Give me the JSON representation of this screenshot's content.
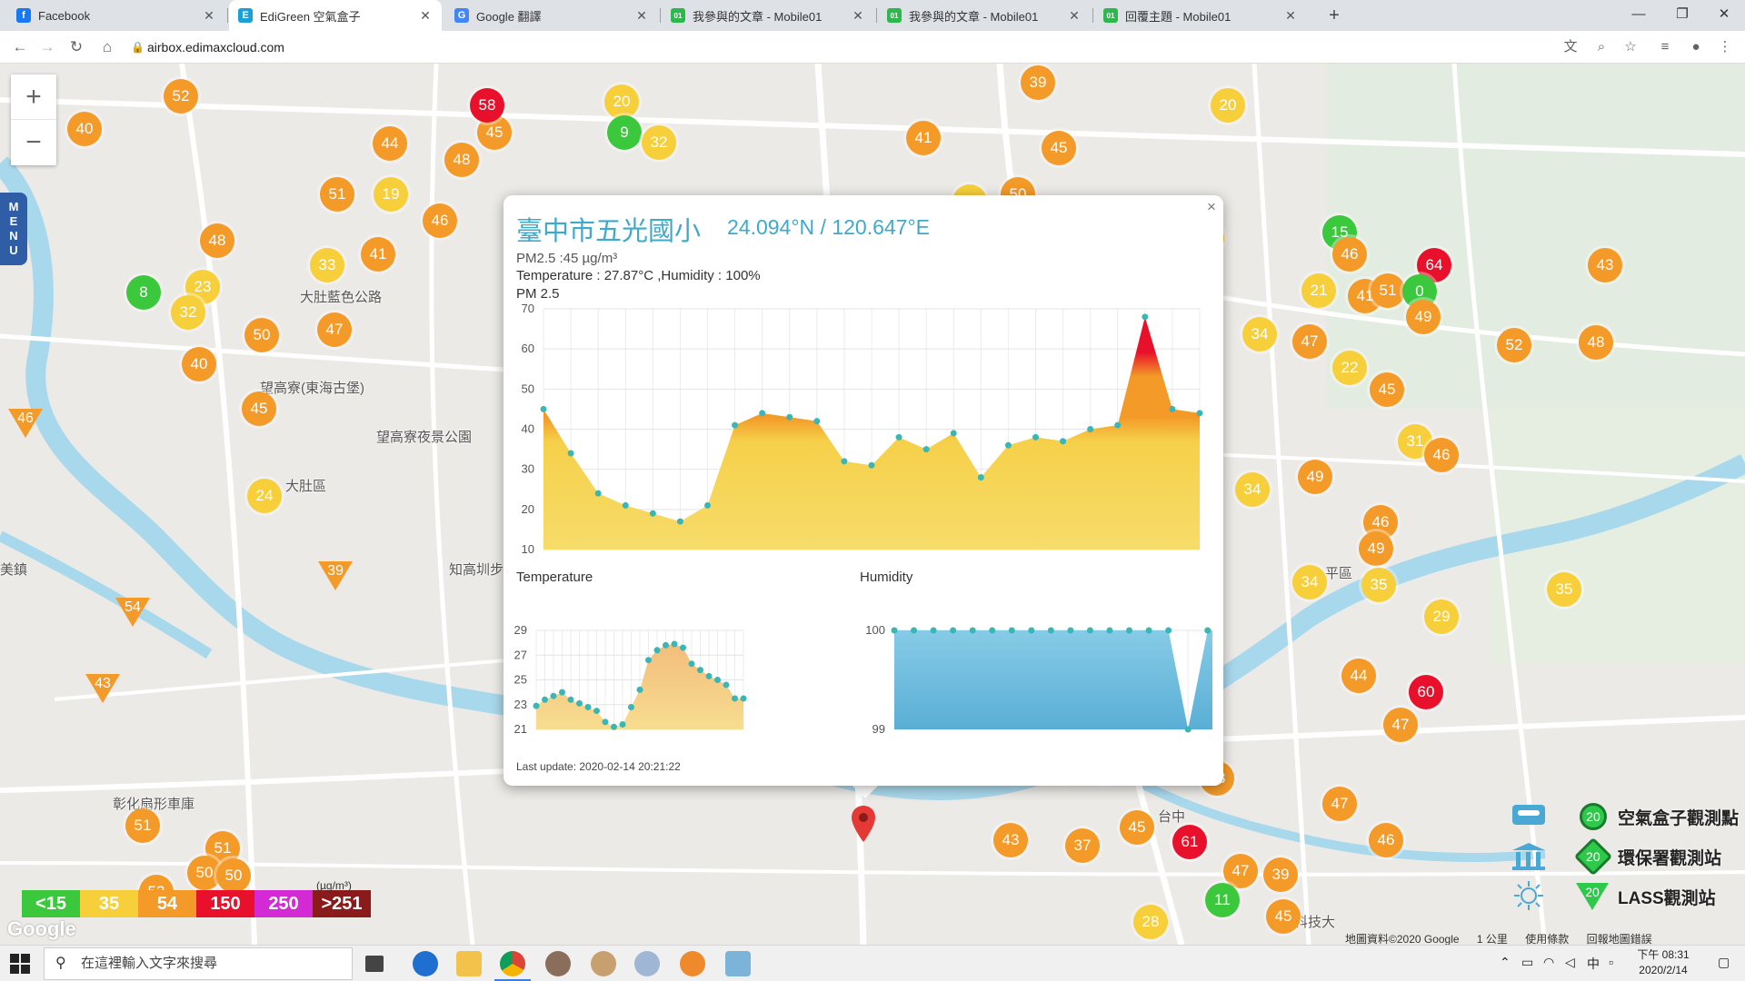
{
  "browser": {
    "tabs": [
      {
        "title": "Facebook",
        "favicon": "facebook-icon",
        "color": "#1877f2",
        "glyph": "f"
      },
      {
        "title": "EdiGreen 空氣盒子",
        "favicon": "edigreen-icon",
        "color": "#1a9fd6",
        "glyph": "E",
        "active": true
      },
      {
        "title": "Google 翻譯",
        "favicon": "google-translate-icon",
        "color": "#4285f4",
        "glyph": "G"
      },
      {
        "title": "我參與的文章 - Mobile01",
        "favicon": "mobile01-icon",
        "color": "#2db84c",
        "glyph": "01"
      },
      {
        "title": "我參與的文章 - Mobile01",
        "favicon": "mobile01-icon",
        "color": "#2db84c",
        "glyph": "01"
      },
      {
        "title": "回覆主題 - Mobile01",
        "favicon": "mobile01-icon",
        "color": "#2db84c",
        "glyph": "01"
      }
    ],
    "url": "airbox.edimaxcloud.com"
  },
  "map": {
    "labels": [
      {
        "text": "大肚藍色公路"
      },
      {
        "text": "望高寮(東海古堡)"
      },
      {
        "text": "望高寮夜景公園"
      },
      {
        "text": "大肚區"
      },
      {
        "text": "知高圳步"
      },
      {
        "text": "美鎮"
      },
      {
        "text": "彰化扇形車庫"
      },
      {
        "text": "平區"
      },
      {
        "text": "台中"
      },
      {
        "text": "科技大"
      }
    ],
    "zoom_in": "+",
    "zoom_out": "−",
    "menu_letters": [
      "M",
      "E",
      "N",
      "U"
    ],
    "markers": [
      {
        "v": "52",
        "c": "#f39a28"
      },
      {
        "v": "40",
        "c": "#f39a28"
      },
      {
        "v": "44",
        "c": "#f39a28"
      },
      {
        "v": "45",
        "c": "#f39a28"
      },
      {
        "v": "19",
        "c": "#f6cf3a"
      },
      {
        "v": "46",
        "c": "#f39a28"
      },
      {
        "v": "47",
        "c": "#f39a28"
      },
      {
        "v": "41",
        "c": "#f39a28"
      },
      {
        "v": "50",
        "c": "#f39a28"
      },
      {
        "v": "45",
        "c": "#f39a28"
      },
      {
        "v": "51",
        "c": "#f39a28"
      },
      {
        "v": "48",
        "c": "#f39a28"
      },
      {
        "v": "8",
        "c": "#3cc83c"
      },
      {
        "v": "23",
        "c": "#f6cf3a"
      },
      {
        "v": "33",
        "c": "#f6cf3a"
      },
      {
        "v": "32",
        "c": "#f6cf3a"
      },
      {
        "v": "50",
        "c": "#f39a28"
      },
      {
        "v": "40",
        "c": "#f39a28"
      },
      {
        "v": "45",
        "c": "#f39a28"
      },
      {
        "v": "24",
        "c": "#f6cf3a"
      },
      {
        "v": "51",
        "c": "#f39a28"
      },
      {
        "v": "51",
        "c": "#f39a28"
      },
      {
        "v": "50",
        "c": "#f39a28"
      },
      {
        "v": "50",
        "c": "#f39a28"
      },
      {
        "v": "53",
        "c": "#f39a28"
      },
      {
        "v": "58",
        "c": "#e8102a"
      },
      {
        "v": "48",
        "c": "#f39a28"
      },
      {
        "v": "20",
        "c": "#f6cf3a"
      },
      {
        "v": "9",
        "c": "#3cc83c"
      },
      {
        "v": "32",
        "c": "#f6cf3a"
      },
      {
        "v": "41",
        "c": "#f39a28"
      },
      {
        "v": "35",
        "c": "#f6cf3a"
      },
      {
        "v": "39",
        "c": "#f39a28"
      },
      {
        "v": "20",
        "c": "#f6cf3a"
      },
      {
        "v": "30",
        "c": "#f6cf3a"
      },
      {
        "v": "15",
        "c": "#3cc83c"
      },
      {
        "v": "46",
        "c": "#f39a28"
      },
      {
        "v": "64",
        "c": "#e8102a"
      },
      {
        "v": "43",
        "c": "#f39a28"
      },
      {
        "v": "21",
        "c": "#f6cf3a"
      },
      {
        "v": "41",
        "c": "#f39a28"
      },
      {
        "v": "51",
        "c": "#f39a28"
      },
      {
        "v": "0",
        "c": "#3cc83c"
      },
      {
        "v": "49",
        "c": "#f39a28"
      },
      {
        "v": "34",
        "c": "#f6cf3a"
      },
      {
        "v": "47",
        "c": "#f39a28"
      },
      {
        "v": "52",
        "c": "#f39a28"
      },
      {
        "v": "48",
        "c": "#f39a28"
      },
      {
        "v": "22",
        "c": "#f6cf3a"
      },
      {
        "v": "45",
        "c": "#f39a28"
      },
      {
        "v": "31",
        "c": "#f6cf3a"
      },
      {
        "v": "46",
        "c": "#f39a28"
      },
      {
        "v": "34",
        "c": "#f6cf3a"
      },
      {
        "v": "49",
        "c": "#f39a28"
      },
      {
        "v": "46",
        "c": "#f39a28"
      },
      {
        "v": "49",
        "c": "#f39a28"
      },
      {
        "v": "34",
        "c": "#f6cf3a"
      },
      {
        "v": "35",
        "c": "#f6cf3a"
      },
      {
        "v": "29",
        "c": "#f6cf3a"
      },
      {
        "v": "35",
        "c": "#f6cf3a"
      },
      {
        "v": "44",
        "c": "#f39a28"
      },
      {
        "v": "60",
        "c": "#e8102a"
      },
      {
        "v": "47",
        "c": "#f39a28"
      },
      {
        "v": "42",
        "c": "#f39a28"
      },
      {
        "v": "43",
        "c": "#f39a28"
      },
      {
        "v": "39",
        "c": "#f39a28"
      },
      {
        "v": "43",
        "c": "#f39a28"
      },
      {
        "v": "47",
        "c": "#f39a28"
      },
      {
        "v": "45",
        "c": "#f39a28"
      },
      {
        "v": "37",
        "c": "#f39a28"
      },
      {
        "v": "43",
        "c": "#f39a28"
      },
      {
        "v": "61",
        "c": "#e8102a"
      },
      {
        "v": "46",
        "c": "#f39a28"
      },
      {
        "v": "47",
        "c": "#f39a28"
      },
      {
        "v": "39",
        "c": "#f39a28"
      },
      {
        "v": "11",
        "c": "#3cc83c"
      },
      {
        "v": "45",
        "c": "#f39a28"
      },
      {
        "v": "28",
        "c": "#f6cf3a"
      }
    ],
    "triangles": [
      "46",
      "39",
      "54",
      "43"
    ],
    "legend": [
      {
        "label": "<15",
        "color": "#3cc83c"
      },
      {
        "label": "35",
        "color": "#f6cf3a"
      },
      {
        "label": "54",
        "color": "#f39a28"
      },
      {
        "label": "150",
        "color": "#e8102a"
      },
      {
        "label": "250",
        "color": "#d32ad6"
      },
      {
        "label": ">251",
        "color": "#8b1a1a"
      }
    ],
    "legend_unit": "(µg/m³)",
    "google_logo": "Google",
    "station_legend": [
      {
        "badge": "20",
        "label": "空氣盒子觀測點",
        "icon": "airbox-icon"
      },
      {
        "badge": "20",
        "label": "環保署觀測站",
        "icon": "epa-building-icon"
      },
      {
        "badge": "20",
        "label": "LASS觀測站",
        "icon": "lass-sun-icon"
      }
    ],
    "attribution": [
      "地圖資料©2020 Google",
      "1 公里",
      "使用條款",
      "回報地圖錯誤"
    ]
  },
  "popup": {
    "title": "臺中市五光國小",
    "coords": "24.094°N / 120.647°E",
    "pm25_line": "PM2.5 :45 µg/m³",
    "temp_humidity_line": "Temperature : 27.87°C ,Humidity : 100%",
    "chart_label": "PM 2.5",
    "last_update": "Last update: 2020-02-14 20:21:22",
    "close": "×"
  },
  "chart_data": [
    {
      "type": "area",
      "title": "PM 2.5",
      "x": [
        "20",
        "21",
        "22",
        "23",
        "00",
        "01",
        "02",
        "03",
        "04",
        "05",
        "06",
        "07",
        "08",
        "09",
        "10",
        "11",
        "12",
        "13",
        "14",
        "15",
        "16",
        "17",
        "18",
        "19",
        "20"
      ],
      "xticks": [
        "20",
        "00",
        "04",
        "08",
        "12",
        "16",
        "20"
      ],
      "values": [
        45,
        34,
        24,
        21,
        19,
        17,
        21,
        41,
        44,
        43,
        42,
        32,
        31,
        38,
        35,
        39,
        28,
        36,
        38,
        37,
        40,
        41,
        68,
        45,
        44
      ],
      "ylim": [
        10,
        70
      ],
      "yticks": [
        10,
        20,
        30,
        40,
        50,
        60,
        70
      ],
      "grid": true
    },
    {
      "type": "area",
      "title": "Temperature",
      "values": [
        22.9,
        23.4,
        23.7,
        24.0,
        23.4,
        23.1,
        22.8,
        22.5,
        21.6,
        21.2,
        21.4,
        22.8,
        24.2,
        26.6,
        27.4,
        27.8,
        27.9,
        27.6,
        26.3,
        25.8,
        25.3,
        25.0,
        24.6,
        23.5,
        23.5
      ],
      "ylim": [
        21,
        29
      ],
      "yticks": [
        21,
        23,
        25,
        27,
        29
      ],
      "grid": true
    },
    {
      "type": "area",
      "title": "Humidity",
      "values": [
        100,
        100,
        100,
        100,
        100,
        100,
        100,
        100,
        100,
        100,
        100,
        100,
        100,
        100,
        100,
        99,
        100,
        100,
        100,
        100,
        100,
        100,
        100
      ],
      "ylim": [
        99,
        100
      ],
      "yticks": [
        99,
        100
      ],
      "grid": true
    }
  ],
  "taskbar": {
    "search_placeholder": "在這裡輸入文字來搜尋",
    "clock_time": "下午 08:31",
    "clock_date": "2020/2/14",
    "ime": "中"
  }
}
